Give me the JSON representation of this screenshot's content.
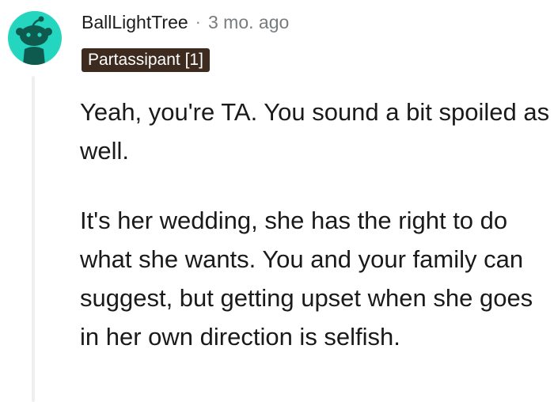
{
  "comment": {
    "author": "BallLightTree",
    "separator": "·",
    "timestamp": "3 mo. ago",
    "flair": "Partassipant [1]",
    "avatar_icon": "snoo-avatar-icon",
    "avatar_color": "#24d6c0",
    "flair_color": "#3d2b20",
    "paragraphs": [
      "Yeah, you're TA. You sound a bit spoiled as well.",
      "It's her wedding, she has the right to do what she wants. You and your family can suggest, but getting upset when she goes in her own direction is selfish."
    ]
  }
}
